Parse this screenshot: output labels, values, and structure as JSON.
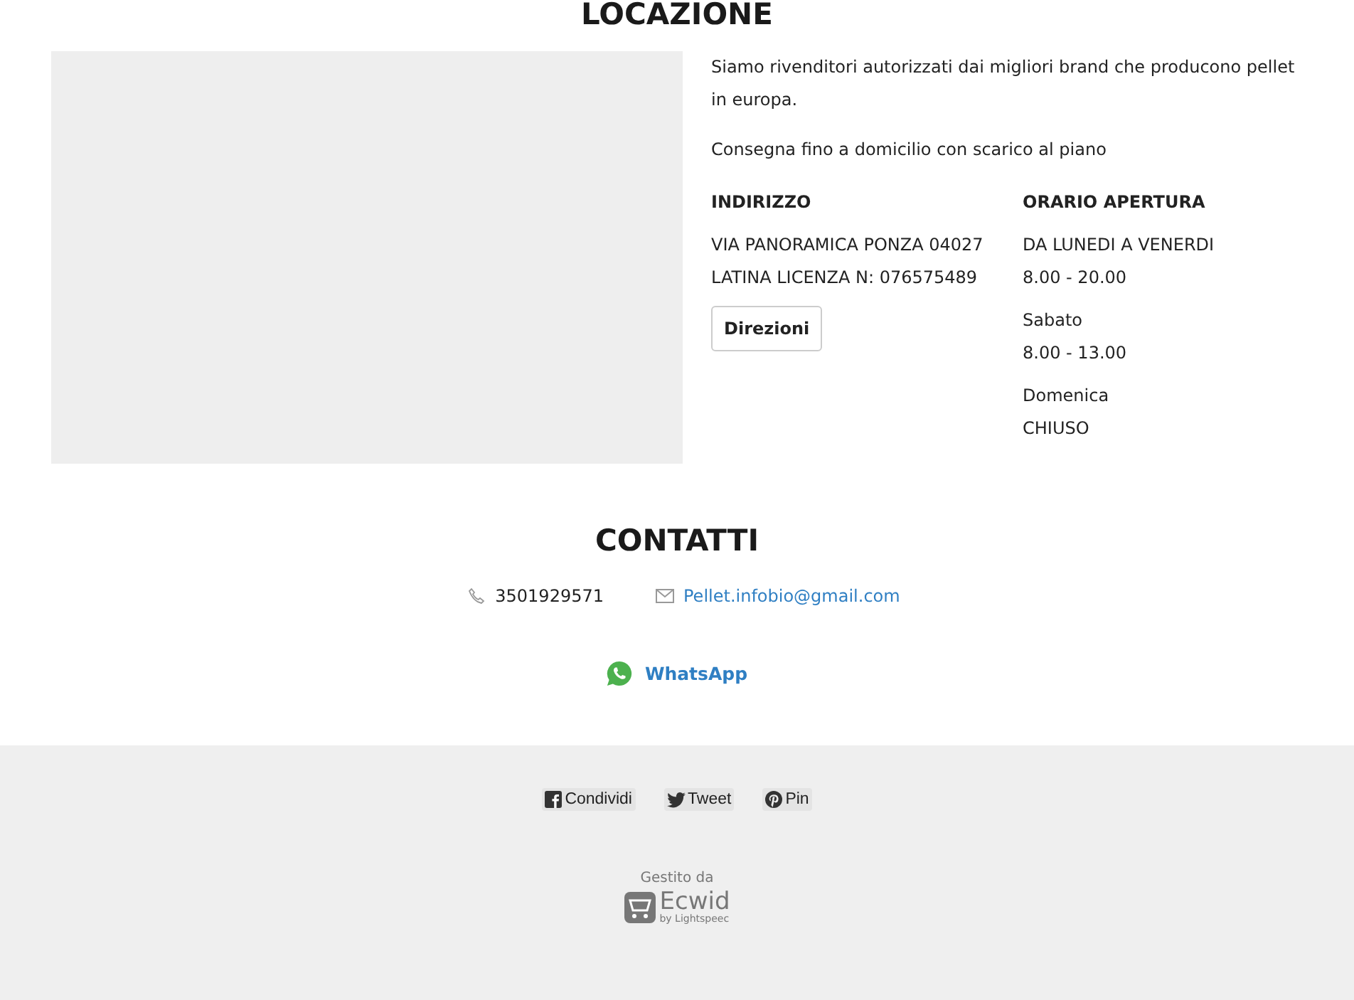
{
  "location": {
    "title": "LOCAZIONE",
    "paragraphs": [
      "Siamo rivenditori autorizzati dai migliori brand che producono pellet in europa.",
      "Consegna fino a domicilio con scarico al piano"
    ],
    "address": {
      "heading": "INDIRIZZO",
      "lines": [
        "VIA PANORAMICA PONZA 04027",
        "LATINA LICENZA N: 076575489"
      ],
      "button": "Direzioni"
    },
    "hours": {
      "heading": "ORARIO APERTURA",
      "groups": [
        {
          "day": "DA LUNEDI A VENERDI",
          "time": "8.00 - 20.00"
        },
        {
          "day": "Sabato",
          "time": "8.00 - 13.00"
        },
        {
          "day": "Domenica",
          "time": "CHIUSO"
        }
      ]
    }
  },
  "contacts": {
    "title": "CONTATTI",
    "phone": "3501929571",
    "email": "Pellet.infobio@gmail.com",
    "whatsapp": "WhatsApp"
  },
  "footer": {
    "share": [
      {
        "kind": "facebook",
        "label": "Condividi"
      },
      {
        "kind": "twitter",
        "label": "Tweet"
      },
      {
        "kind": "pinterest",
        "label": "Pin"
      }
    ],
    "powered_by": "Gestito da",
    "brand": "Ecwid",
    "brand_sub": "by Lightspeec"
  }
}
